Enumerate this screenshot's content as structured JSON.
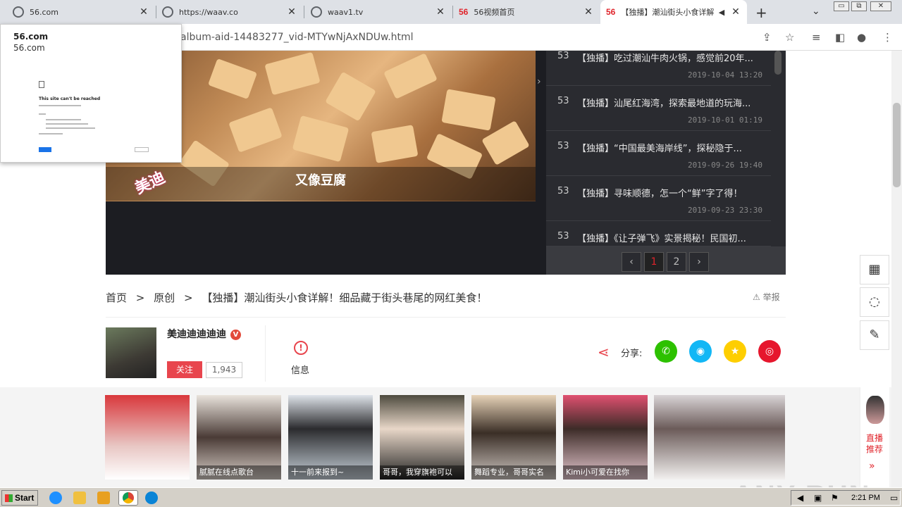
{
  "browser": {
    "tabs": [
      {
        "label": "56.com",
        "icon": "globe-icon"
      },
      {
        "label": "https://waav.co",
        "icon": "globe-icon"
      },
      {
        "label": "waav1.tv",
        "icon": "globe-icon"
      },
      {
        "label": "56视频首页",
        "icon": "56-logo-icon"
      },
      {
        "label": "【独播】潮汕街头小食详解",
        "icon": "56-logo-icon",
        "active": true
      }
    ],
    "favicon_text": "56",
    "url": "album-aid-14483277_vid-MTYwNjAxNDUw.html",
    "window_buttons": [
      "▭",
      "⧉",
      "✕"
    ]
  },
  "popup": {
    "title": "56.com",
    "url": "56.com",
    "mini_title": "This site can't be reached"
  },
  "player": {
    "caption": "又像豆腐",
    "watermark": "美迪"
  },
  "playlist": {
    "items": [
      {
        "num": "53",
        "title": "【独播】吃过潮汕牛肉火锅，感觉前20年...",
        "date": "2019-10-04 13:20"
      },
      {
        "num": "53",
        "title": "【独播】汕尾红海湾，探索最地道的玩海...",
        "date": "2019-10-01 01:19"
      },
      {
        "num": "53",
        "title": "【独播】“中国最美海岸线”，探秘隐于...",
        "date": "2019-09-26 19:40"
      },
      {
        "num": "53",
        "title": "【独播】寻味顺德，怎一个“鲜”字了得！",
        "date": "2019-09-23 23:30"
      },
      {
        "num": "53",
        "title": "【独播】《让子弹飞》实景揭秘！民国初...",
        "date": ""
      }
    ],
    "pager": {
      "prev": "‹",
      "pages": [
        "1",
        "2"
      ],
      "current": "1",
      "next": "›"
    }
  },
  "breadcrumb": {
    "home": "首页",
    "sep": ">",
    "category": "原创",
    "title": "【独播】潮汕街头小食详解！细品藏于街头巷尾的网红美食！"
  },
  "report_label": "举报",
  "author": {
    "name": "美迪迪迪迪迪",
    "badge": "V",
    "follow_label": "关注",
    "followers": "1,943"
  },
  "info_label": "信息",
  "share": {
    "label": "分享:",
    "buttons": [
      {
        "name": "wechat",
        "color": "#2dc100",
        "glyph": "✆"
      },
      {
        "name": "qq",
        "color": "#12b7f5",
        "glyph": "◉"
      },
      {
        "name": "qzone",
        "color": "#fece00",
        "glyph": "★"
      },
      {
        "name": "weibo",
        "color": "#e6162d",
        "glyph": "◎"
      }
    ]
  },
  "thumbs": [
    {
      "label": ""
    },
    {
      "label": "腻腻在线点歌台"
    },
    {
      "label": "十一前来报到~"
    },
    {
      "label": "哥哥，我穿旗袍可以"
    },
    {
      "label": "舞蹈专业，哥哥实名"
    },
    {
      "label": "Kimi小可爱在找你"
    },
    {
      "label": ""
    }
  ],
  "live": {
    "label": "直播推荐",
    "arrow": "»"
  },
  "taskbar": {
    "start": "Start",
    "time": "2:21 PM"
  },
  "watermark_brand": "ANY RUN"
}
